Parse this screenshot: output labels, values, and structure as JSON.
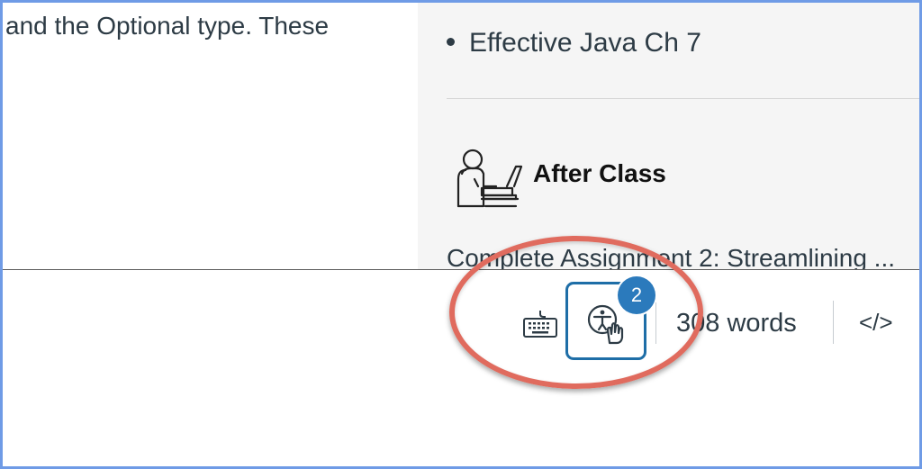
{
  "content": {
    "left_text": "and the Optional type. These",
    "bullet": "Effective Java Ch 7",
    "after_class_heading": "After Class",
    "after_class_icon": "person-at-laptop-icon",
    "assignment_text": "Complete Assignment 2: Streamlining ..."
  },
  "status_bar": {
    "keyboard_icon": "keyboard-icon",
    "accessibility_icon": "accessibility-checker-icon",
    "accessibility_issue_count": "2",
    "word_count": "308 words",
    "html_toggle": "</>"
  },
  "colors": {
    "frame_border": "#6f9be6",
    "highlight_ellipse": "#e06b5e",
    "accessibility_button_border": "#1e6ea7",
    "badge": "#2b7abc"
  }
}
